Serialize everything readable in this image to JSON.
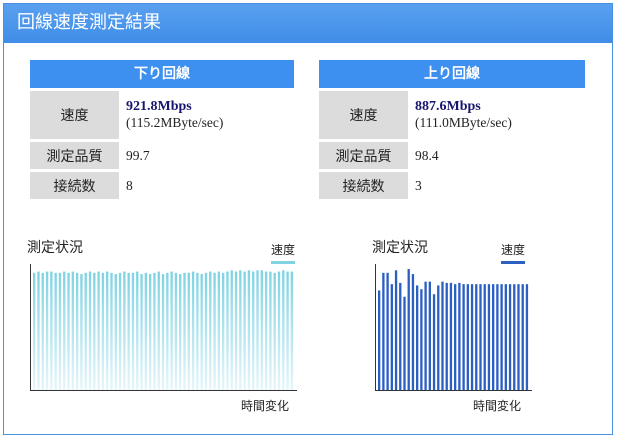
{
  "window": {
    "title": "回線速度測定結果"
  },
  "download": {
    "heading": "下り回線",
    "speed_label": "速度",
    "speed_value": "921.8Mbps",
    "speed_sub": "(115.2MByte/sec)",
    "quality_label": "測定品質",
    "quality_value": "99.7",
    "connections_label": "接続数",
    "connections_value": "8"
  },
  "upload": {
    "heading": "上り回線",
    "speed_label": "速度",
    "speed_value": "887.6Mbps",
    "speed_sub": "(111.0MByte/sec)",
    "quality_label": "測定品質",
    "quality_value": "98.4",
    "connections_label": "接続数",
    "connections_value": "3"
  },
  "charts": {
    "down": {
      "title": "測定状況",
      "legend": "速度",
      "xlabel": "時間変化",
      "color": "#7fd3e3"
    },
    "up": {
      "title": "測定状況",
      "legend": "速度",
      "xlabel": "時間変化",
      "color": "#2b5fc2"
    }
  },
  "chart_data": [
    {
      "type": "bar",
      "title": "測定状況",
      "xlabel": "時間変化",
      "series": [
        {
          "name": "速度",
          "values": [
            93,
            94,
            93,
            94,
            94,
            93,
            93,
            94,
            93,
            94,
            93,
            92,
            93,
            94,
            93,
            94,
            93,
            94,
            93,
            92,
            93,
            94,
            93,
            93,
            94,
            92,
            93,
            92,
            93,
            94,
            92,
            93,
            94,
            93,
            92,
            93,
            93,
            94,
            93,
            92,
            93,
            94,
            93,
            94,
            93,
            94,
            95,
            94,
            95,
            94,
            95,
            94,
            95,
            95,
            94,
            94,
            93,
            94,
            95,
            94,
            94
          ]
        }
      ]
    },
    {
      "type": "bar",
      "title": "測定状況",
      "xlabel": "時間変化",
      "series": [
        {
          "name": "速度",
          "values": [
            79,
            93,
            93,
            84,
            95,
            85,
            74,
            96,
            92,
            83,
            80,
            86,
            86,
            76,
            83,
            86,
            85,
            85,
            84,
            85,
            84,
            84,
            84,
            84,
            84,
            84,
            84,
            84,
            84,
            84,
            84,
            84,
            84,
            84,
            84,
            84
          ]
        }
      ]
    }
  ]
}
